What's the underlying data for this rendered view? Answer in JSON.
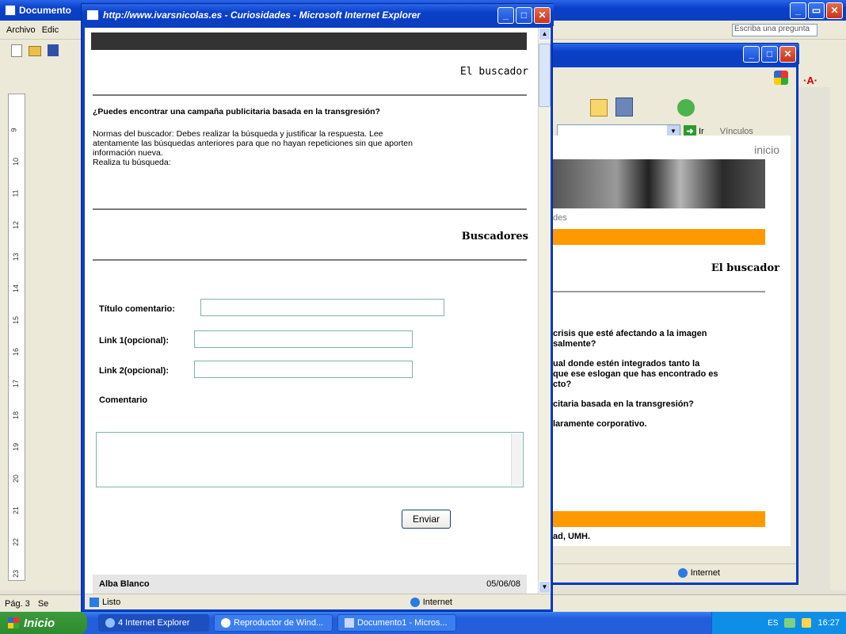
{
  "word": {
    "title": "Documento",
    "menu": [
      "Archivo",
      "Edic"
    ],
    "question_box": "Escriba una pregunta",
    "status": {
      "page": "Pág. 3",
      "sec": "Se"
    },
    "ruler_marks": [
      "9",
      "10",
      "11",
      "12",
      "13",
      "14",
      "15",
      "16",
      "17",
      "18",
      "19",
      "20",
      "21",
      "22",
      "23"
    ]
  },
  "ie_back": {
    "nav_go": "Ir",
    "links": "Vínculos",
    "inicio": "inicio",
    "fragment_des": "des",
    "section_title": "El buscador",
    "fragments": [
      "crisis que esté afectando a la imagen",
      "salmente?",
      "ual donde estén integrados tanto la",
      "que ese eslogan que has encontrado es",
      "cto?",
      "citaria basada en la transgresión?",
      "laramente corporativo."
    ],
    "footer_fragment": "ad, UMH.",
    "status_zone": "Internet"
  },
  "ie_front": {
    "title": "http://www.ivarsnicolas.es - Curiosidades - Microsoft Internet Explorer",
    "header": "El buscador",
    "question": "¿Puedes encontrar una campaña publicitaria basada en la transgresión?",
    "rules_line1": "Normas del buscador: Debes realizar la búsqueda y justificar la respuesta.  Lee",
    "rules_line2": "atentamente las búsquedas anteriores para que no hayan repeticiones sin que aporten",
    "rules_line3": "información nueva.",
    "prompt": "Realiza tu búsqueda:",
    "section": "Buscadores",
    "form": {
      "title_label": "Título comentario:",
      "link1_label": "Link 1(opcional):",
      "link2_label": "Link 2(opcional):",
      "comment_label": "Comentario",
      "title_value": "",
      "link1_value": "",
      "link2_value": "",
      "comment_value": "",
      "submit": "Enviar"
    },
    "entry": {
      "author": "Alba Blanco",
      "date": "05/06/08"
    },
    "status": {
      "text": "Listo",
      "zone": "Internet"
    }
  },
  "taskbar": {
    "start": "Inicio",
    "tasks": [
      "4 Internet Explorer",
      "Reproductor de Wind...",
      "Documento1 - Micros..."
    ],
    "lang": "ES",
    "clock": "16:27"
  }
}
